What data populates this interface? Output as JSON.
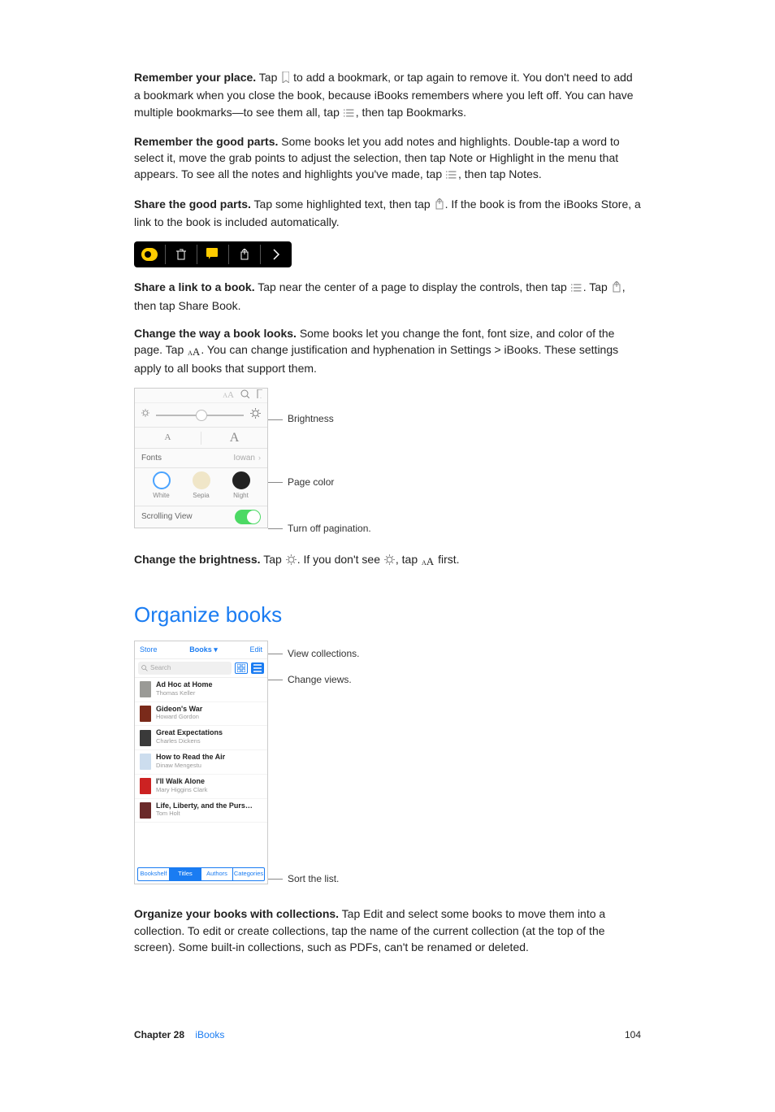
{
  "p1": {
    "lead": "Remember your place.",
    "a": " Tap ",
    "b": " to add a bookmark, or tap again to remove it. You don't need to add a bookmark when you close the book, because iBooks remembers where you left off. You can have multiple bookmarks—to see them all, tap ",
    "c": ", then tap Bookmarks."
  },
  "p2": {
    "lead": "Remember the good parts.",
    "a": " Some books let you add notes and highlights. Double-tap a word to select it, move the grab points to adjust the selection, then tap Note or Highlight in the menu that appears. To see all the notes and highlights you've made, tap ",
    "b": ", then tap Notes."
  },
  "p3": {
    "lead": "Share the good parts.",
    "a": " Tap some highlighted text, then tap ",
    "b": ". If the book is from the iBooks Store, a link to the book is included automatically."
  },
  "p4": {
    "lead": "Share a link to a book.",
    "a": " Tap near the center of a page to display the controls, then tap ",
    "b": ". Tap ",
    "c": ", then tap Share Book."
  },
  "p5": {
    "lead": "Change the way a book looks.",
    "a": " Some books let you change the font, font size, and color of the page. Tap ",
    "b": ". You can change justification and hyphenation in Settings > iBooks. These settings apply to all books that support them."
  },
  "appearance": {
    "fonts_label": "Fonts",
    "font_name": "Iowan",
    "colors": {
      "white": "White",
      "sepia": "Sepia",
      "night": "Night"
    },
    "scrolling_label": "Scrolling View",
    "callout_brightness": "Brightness",
    "callout_pagecolor": "Page color",
    "callout_pagination": "Turn off pagination."
  },
  "p6": {
    "lead": "Change the brightness.",
    "a": " Tap ",
    "b": ". If you don't see ",
    "c": ", tap ",
    "d": " first."
  },
  "organize_heading": "Organize books",
  "organize": {
    "store": "Store",
    "books": "Books",
    "edit": "Edit",
    "search_placeholder": "Search",
    "items": [
      {
        "title": "Ad Hoc at Home",
        "author": "Thomas Keller"
      },
      {
        "title": "Gideon's War",
        "author": "Howard Gordon"
      },
      {
        "title": "Great Expectations",
        "author": "Charles Dickens"
      },
      {
        "title": "How to Read the Air",
        "author": "Dinaw Mengestu"
      },
      {
        "title": "I'll Walk Alone",
        "author": "Mary Higgins Clark"
      },
      {
        "title": "Life, Liberty, and the Purs…",
        "author": "Tom Holt"
      }
    ],
    "tabs": [
      "Bookshelf",
      "Titles",
      "Authors",
      "Categories"
    ],
    "callout_viewcol": "View collections.",
    "callout_changeviews": "Change views.",
    "callout_sort": "Sort the list."
  },
  "p7": {
    "lead": "Organize your books with collections.",
    "a": " Tap Edit and select some books to move them into a collection. To edit or create collections, tap the name of the current collection (at the top of the screen). Some built-in collections, such as PDFs, can't be renamed or deleted."
  },
  "footer": {
    "chapter_label": "Chapter  28",
    "chapter_name": "iBooks",
    "page": "104"
  }
}
